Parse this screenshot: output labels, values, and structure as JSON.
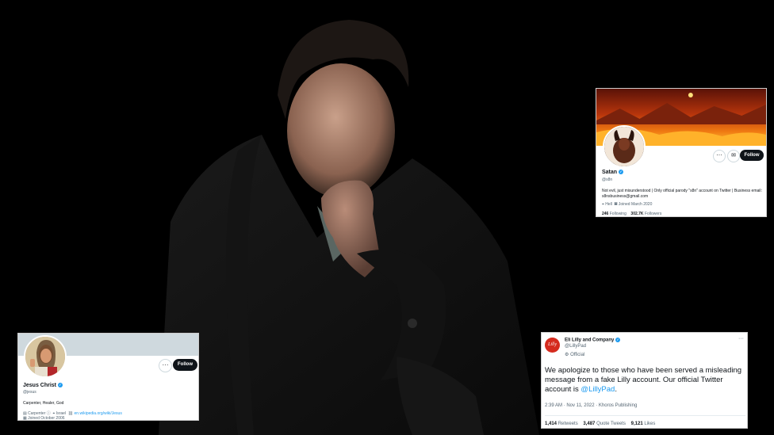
{
  "satan": {
    "name": "Satan",
    "handle": "@s8n",
    "bio": "Not evil, just misunderstood | Only official parody \"s8n\" account on Twitter | Business email: s8nsbusiness@gmail.com",
    "location": "Hell",
    "joined": "Joined March 2020",
    "following_count": "246",
    "following_label": "Following",
    "followers_count": "302.7K",
    "followers_label": "Followers",
    "follow_label": "Follow"
  },
  "jesus": {
    "name": "Jesus Christ",
    "handle": "@jesus",
    "bio": "Carpenter, Healer, God",
    "profession": "Carpenter",
    "location": "Israel",
    "website": "en.wikipedia.org/wiki/Jesus",
    "joined": "Joined October 2006",
    "follow_label": "Follow"
  },
  "lilly": {
    "name": "Eli Lilly and Company",
    "handle": "@LillyPad",
    "official": "Official",
    "logo_text": "Lilly",
    "text_before": "We apologize to those who have been served a misleading message from a fake Lilly account. Our official Twitter account is ",
    "mention": "@LillyPad",
    "text_after": ".",
    "timestamp": "2:39 AM · Nov 11, 2022 · Khoros Publishing",
    "retweets_count": "1,414",
    "retweets_label": "Retweets",
    "quotes_count": "3,487",
    "quotes_label": "Quote Tweets",
    "likes_count": "9,121",
    "likes_label": "Likes"
  }
}
